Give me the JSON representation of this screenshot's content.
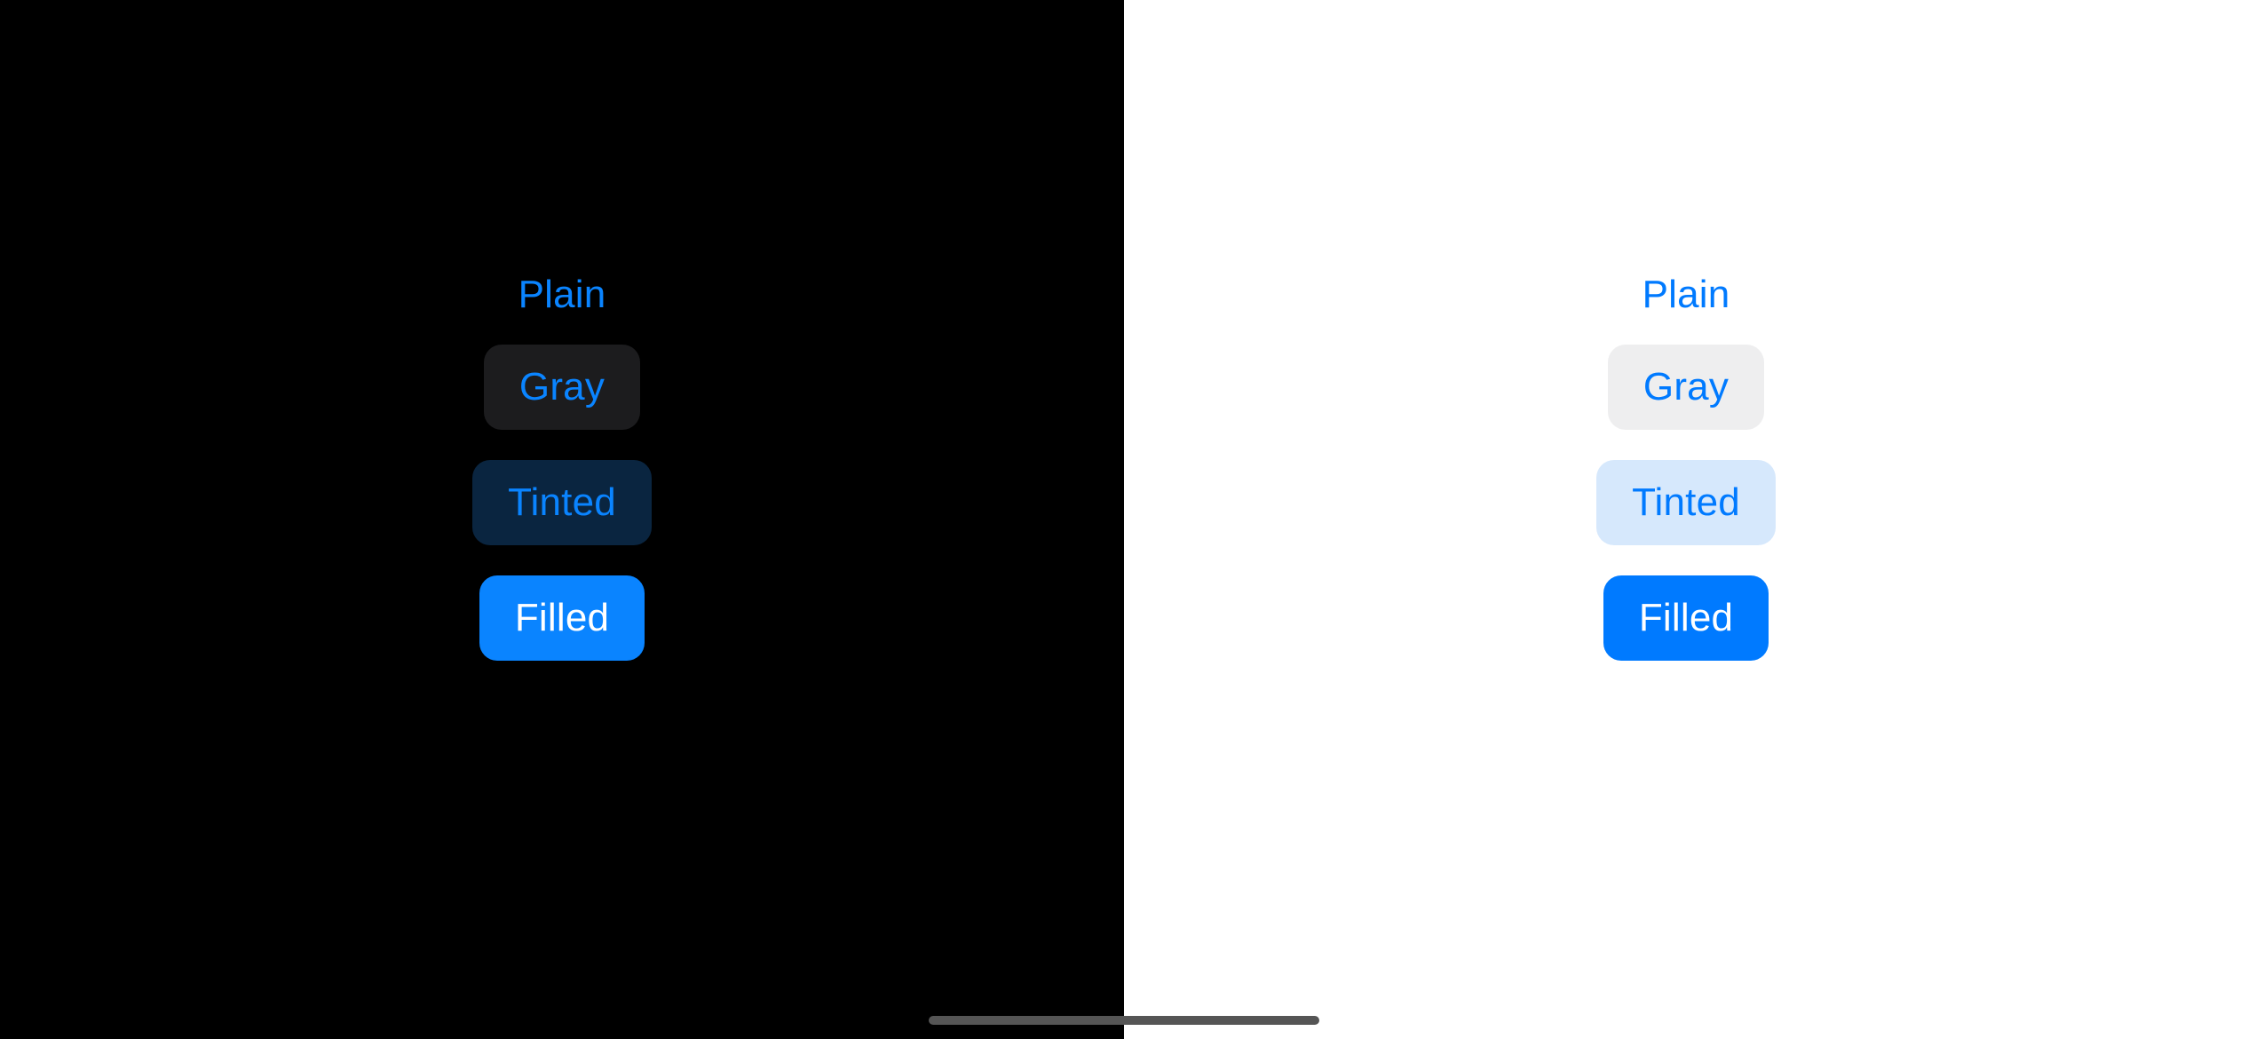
{
  "dark": {
    "buttons": {
      "plain": "Plain",
      "gray": "Gray",
      "tinted": "Tinted",
      "filled": "Filled"
    }
  },
  "light": {
    "buttons": {
      "plain": "Plain",
      "gray": "Gray",
      "tinted": "Tinted",
      "filled": "Filled"
    }
  },
  "colors": {
    "dark_bg": "#000000",
    "light_bg": "#ffffff",
    "dark_tint": "#0a84ff",
    "light_tint": "#007aff",
    "dark_gray_fill": "#1c1c1e",
    "light_gray_fill": "#eeeeef",
    "dark_tinted_fill": "#0a2540",
    "light_tinted_fill": "#d6e8fc"
  }
}
